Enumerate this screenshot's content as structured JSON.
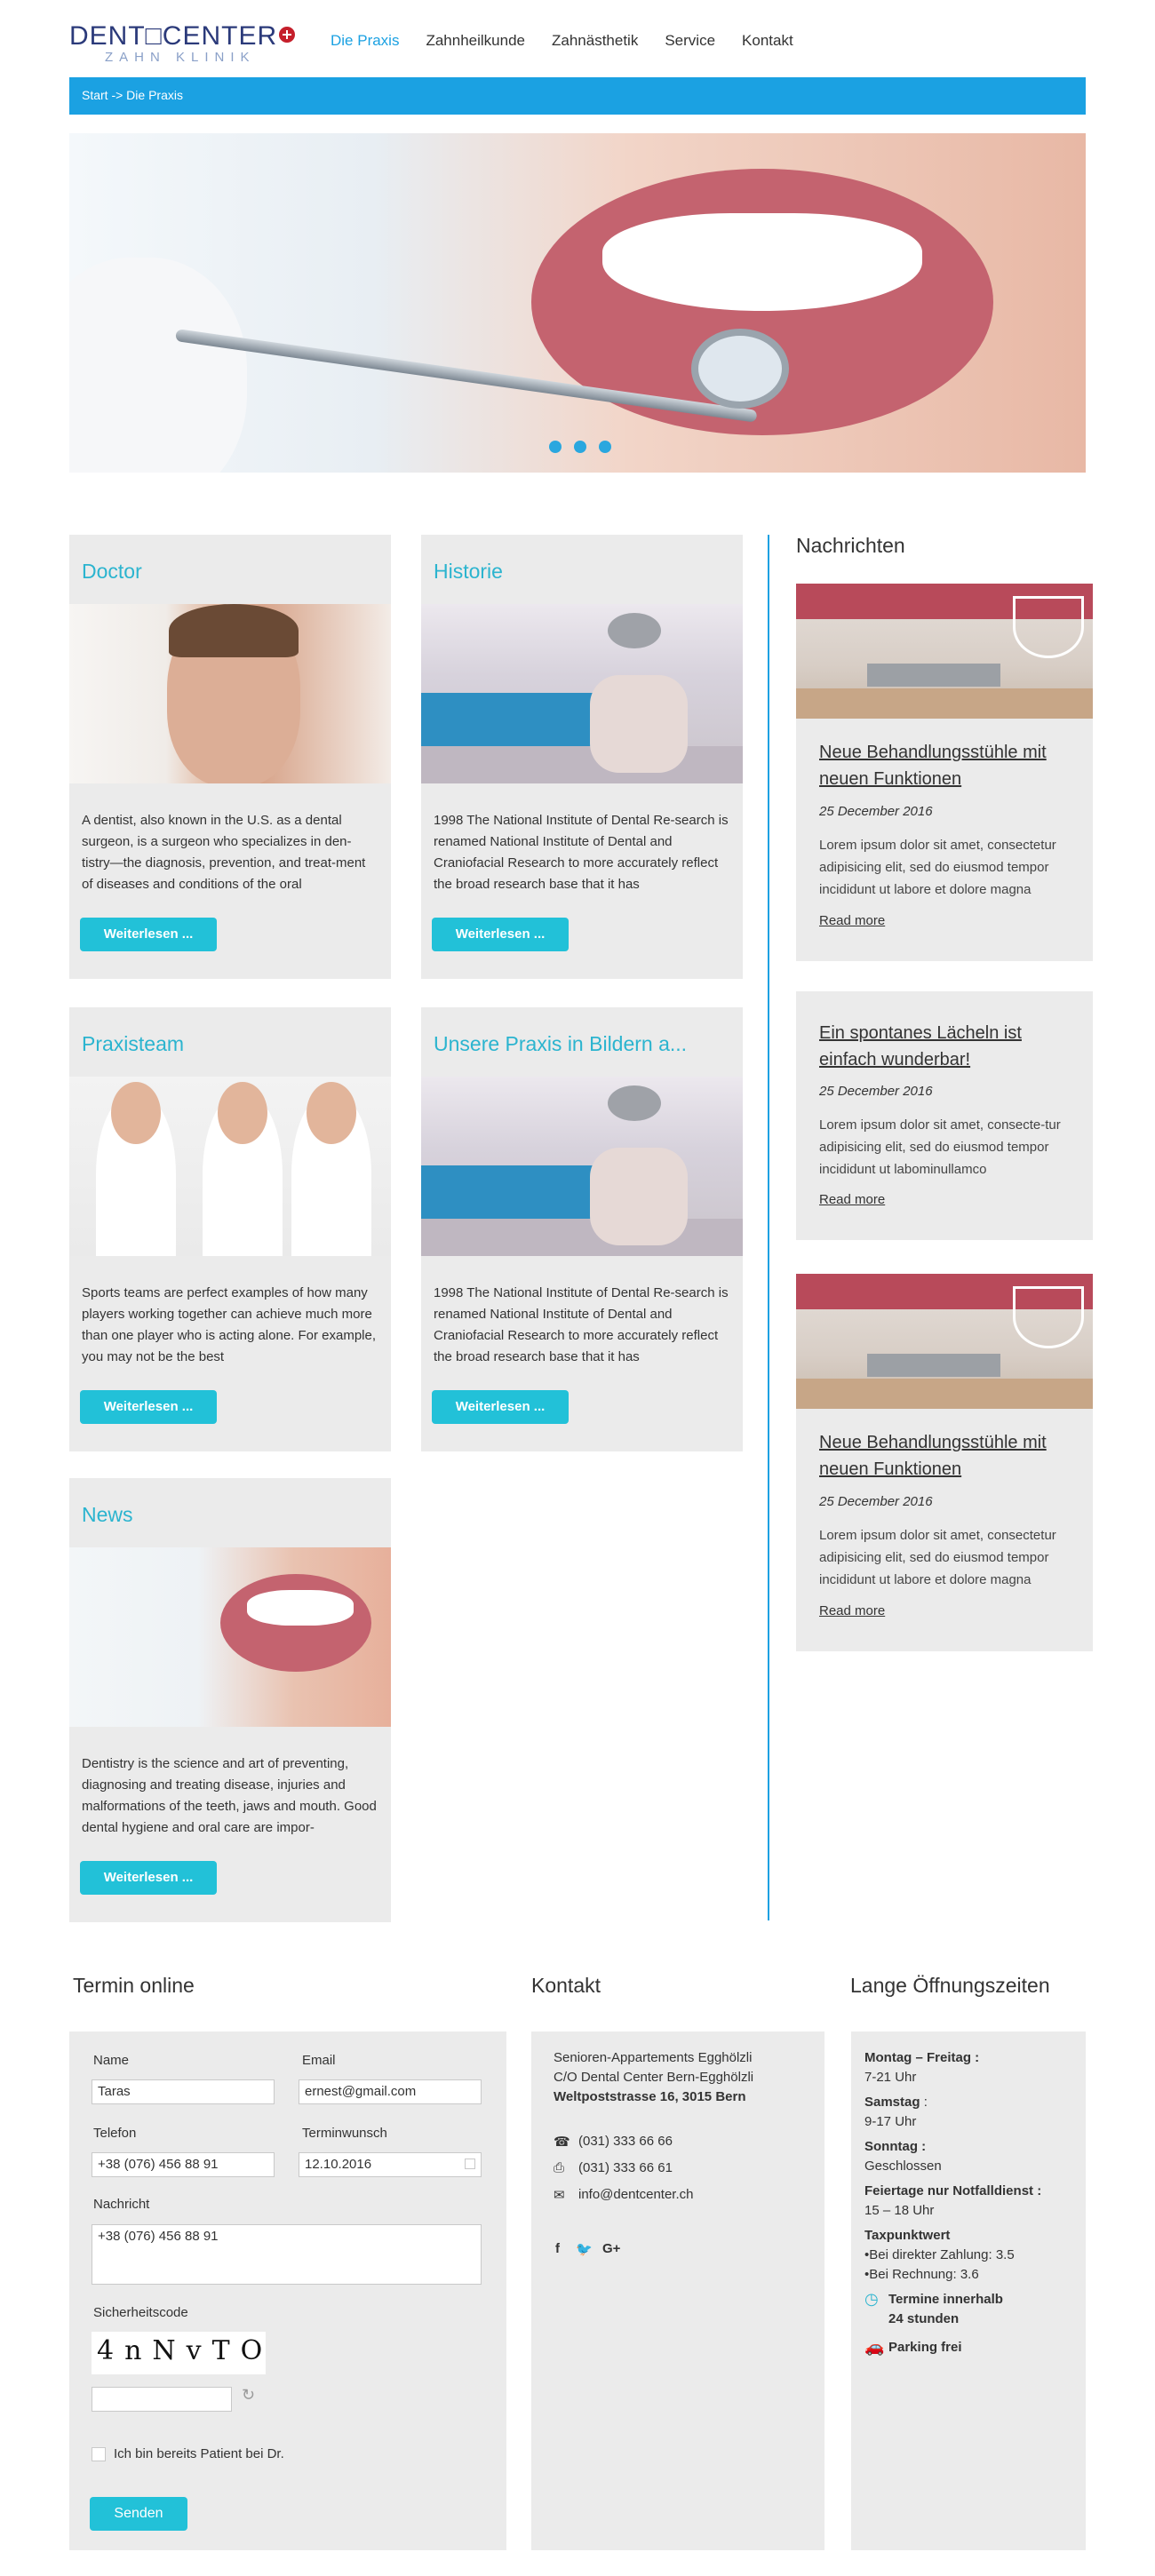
{
  "header": {
    "logo_text": "DENT□CENTER",
    "logo_sub": "ZAHN KLINIK",
    "nav": [
      {
        "label": "Die Praxis",
        "active": true
      },
      {
        "label": "Zahnheilkunde",
        "active": false
      },
      {
        "label": "Zahnästhetik",
        "active": false
      },
      {
        "label": "Service",
        "active": false
      },
      {
        "label": "Kontakt",
        "active": false
      }
    ]
  },
  "breadcrumb": "Start  -> Die Praxis",
  "hero": {
    "slides": 3,
    "active_slide": 1,
    "accent": "#2aa7df"
  },
  "cards": [
    {
      "title": "Doctor",
      "text": "A dentist, also known in the U.S. as a dental surgeon, is a surgeon who specializes in den-tistry—the diagnosis, prevention, and treat-ment of diseases and conditions of the oral",
      "button": "Weiterlesen ..."
    },
    {
      "title": "Historie",
      "text": "1998 The National Institute of Dental Re-search is renamed National Institute of Dental and Craniofacial Research to more accurately reflect the broad research base that it has",
      "button": "Weiterlesen ..."
    },
    {
      "title": "Praxisteam",
      "text": "Sports teams are perfect examples of how many players working together can achieve much more than one player who is acting alone. For example, you may not be the best",
      "button": "Weiterlesen ..."
    },
    {
      "title": "Unsere Praxis in Bildern a...",
      "text": "1998 The National Institute of Dental Re-search is renamed National Institute of Dental and Craniofacial Research to more accurately reflect the broad research base that it has",
      "button": "Weiterlesen ..."
    },
    {
      "title": "News",
      "text": "Dentistry is the science and art of preventing, diagnosing and treating disease, injuries and malformations of the teeth, jaws and mouth. Good dental hygiene and oral care are impor-",
      "button": "Weiterlesen ..."
    }
  ],
  "news": {
    "heading": "Nachrichten",
    "items": [
      {
        "title": "Neue  Behandlungsstühle mit neuen Funktionen",
        "date": "25 December 2016",
        "text": "Lorem ipsum dolor sit amet, consectetur adipisicing elit, sed do eiusmod tempor incididunt ut labore et dolore magna",
        "more": "Read more"
      },
      {
        "title": "Ein spontanes Lächeln ist einfach wunderbar!",
        "date": "25 December 2016",
        "text": "Lorem ipsum dolor sit amet, consecte-tur adipisicing elit, sed do eiusmod tempor incididunt ut labominullamco",
        "more": "Read more"
      },
      {
        "title": "Neue  Behandlungsstühle mit neuen Funktionen",
        "date": "25 December 2016",
        "text": "Lorem ipsum dolor sit amet, consectetur adipisicing elit, sed do eiusmod tempor incididunt ut labore et dolore magna",
        "more": "Read more"
      }
    ]
  },
  "termin": {
    "heading": "Termin online",
    "name_label": "Name",
    "name_value": "Taras",
    "email_label": "Email",
    "email_value": "ernest@gmail.com",
    "phone_label": "Telefon",
    "phone_value": "+38 (076) 456 88 91",
    "wish_label": "Terminwunsch",
    "wish_value": "12.10.2016",
    "message_label": "Nachricht",
    "message_value": "+38 (076) 456 88 91",
    "captcha_label": "Sicherheitscode",
    "captcha_text": "4nNvTO",
    "checkbox_label": "Ich bin bereits Patient bei Dr.",
    "send": "Senden"
  },
  "kontakt": {
    "heading": "Kontakt",
    "line1": "Senioren-Appartements Egghölzli",
    "line2": "C/O Dental Center Bern-Egghölzli",
    "line3": "Weltpoststrasse 16, 3015 Bern",
    "phone": "(031) 333 66 66",
    "fax": "(031) 333 66 61",
    "email": "info@dentcenter.ch",
    "social": [
      "f",
      "twitter",
      "G+"
    ]
  },
  "hours": {
    "heading": "Lange Öffnungszeiten",
    "mf_label": "Montag – Freitag :",
    "mf_value": "7-21 Uhr",
    "sa_label": "Samstag",
    "sa_colon": " :",
    "sa_value": "9-17 Uhr",
    "so_label": "Sonntag :",
    "so_value": "Geschlossen",
    "holiday_label": "Feiertage nur Notfalldienst :",
    "holiday_value": "15 – 18 Uhr",
    "tax_label": "Taxpunktwert",
    "tax_line1": "•Bei direkter Zahlung: 3.5",
    "tax_line2": "•Bei Rechnung: 3.6",
    "appt_line1": "Termine innerhalb",
    "appt_line2": "24 stunden",
    "parking": "Parking frei"
  }
}
